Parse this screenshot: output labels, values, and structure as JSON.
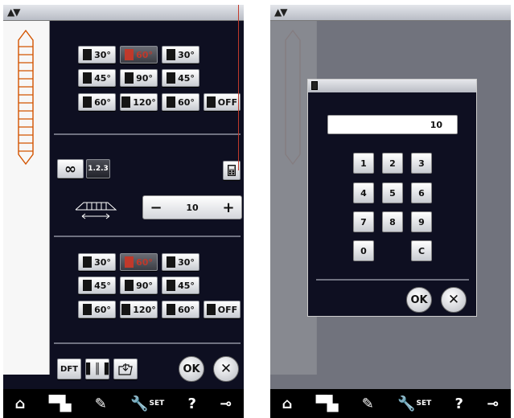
{
  "left": {
    "stitch_top": [
      {
        "label": "30°"
      },
      {
        "label": "60°",
        "selected": true
      },
      {
        "label": "30°"
      },
      {
        "label": "45°"
      },
      {
        "label": "90°"
      },
      {
        "label": "45°"
      },
      {
        "label": "60°"
      },
      {
        "label": "120°"
      },
      {
        "label": "60°"
      },
      {
        "label": "OFF"
      }
    ],
    "stitch_bottom": [
      {
        "label": "30°"
      },
      {
        "label": "60°",
        "selected": true
      },
      {
        "label": "30°"
      },
      {
        "label": "45°"
      },
      {
        "label": "90°"
      },
      {
        "label": "45°"
      },
      {
        "label": "60°"
      },
      {
        "label": "120°"
      },
      {
        "label": "60°"
      },
      {
        "label": "OFF"
      }
    ],
    "infinity_label": "∞",
    "sequence_label": "1.2.3",
    "width_value": "10",
    "minus_label": "−",
    "plus_label": "+",
    "dft_label": "DFT",
    "ok_label": "OK",
    "cancel_label": "✕"
  },
  "right": {
    "numpad_display": "10",
    "keys": [
      "1",
      "2",
      "3",
      "4",
      "5",
      "6",
      "7",
      "8",
      "9",
      "0",
      "C"
    ],
    "ok_label": "OK",
    "cancel_label": "✕"
  },
  "bottombar": {
    "home_icon": "⌂",
    "set_label": "SET",
    "help_label": "?"
  }
}
